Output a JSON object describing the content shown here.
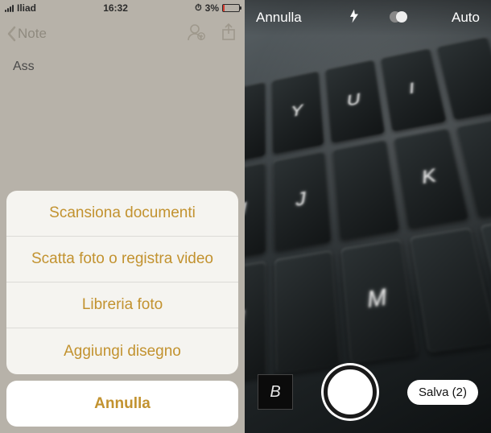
{
  "left": {
    "status": {
      "carrier": "Iliad",
      "time": "16:32",
      "battery_percent": "3%"
    },
    "nav": {
      "back_label": "Note"
    },
    "note": {
      "content": "Ass"
    },
    "action_sheet": {
      "items": [
        "Scansiona documenti",
        "Scatta foto o registra video",
        "Libreria foto",
        "Aggiungi disegno"
      ],
      "cancel": "Annulla"
    }
  },
  "right": {
    "top": {
      "cancel": "Annulla",
      "mode": "Auto"
    },
    "bottom": {
      "thumb_letter": "B",
      "save_label": "Salva (2)"
    },
    "keyboard_keys": [
      "",
      "Y",
      "U",
      "I",
      "",
      "H",
      "J",
      "",
      "K",
      "",
      "N",
      "",
      "M",
      "",
      ""
    ]
  }
}
